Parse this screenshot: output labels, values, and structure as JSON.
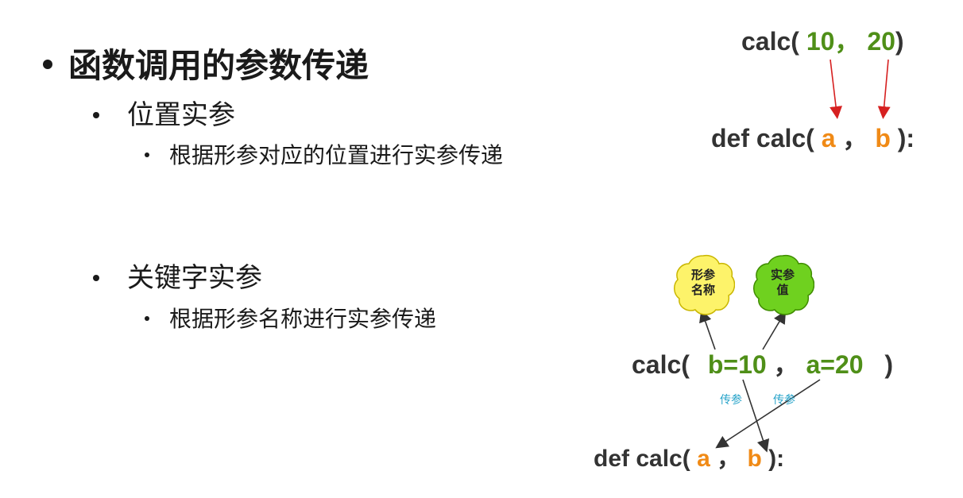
{
  "outline": {
    "title": "函数调用的参数传递",
    "positional": {
      "label": "位置实参",
      "desc": "根据形参对应的位置进行实参传递"
    },
    "keyword": {
      "label": "关键字实参",
      "desc": "根据形参名称进行实参传递"
    }
  },
  "diagram_positional": {
    "call_prefix": "calc(",
    "arg1": "10",
    "sep": "，",
    "arg2": "20",
    "call_suffix": ")",
    "def_prefix": "def calc(",
    "param1": "a",
    "param_sep": "，",
    "param2": "b",
    "def_suffix": "):"
  },
  "diagram_keyword": {
    "cloud_formal_line1": "形参",
    "cloud_formal_line2": "名称",
    "cloud_actual_line1": "实参",
    "cloud_actual_line2": "值",
    "call_prefix": "calc(",
    "kw1": "b=10",
    "sep": "，",
    "kw2": "a=20",
    "call_suffix": ")",
    "pass_label_left": "传参",
    "pass_label_right": "传参",
    "def_prefix": "def calc(",
    "param1": "a",
    "param_sep": "，",
    "param2": "b",
    "def_suffix": "):"
  },
  "colors": {
    "arg_green": "#4f8f18",
    "param_orange": "#f08a16",
    "arrow_red": "#d62020",
    "cloud_yellow": "#fdf36a",
    "cloud_green": "#6fd11f",
    "label_cyan": "#27a3c9"
  }
}
